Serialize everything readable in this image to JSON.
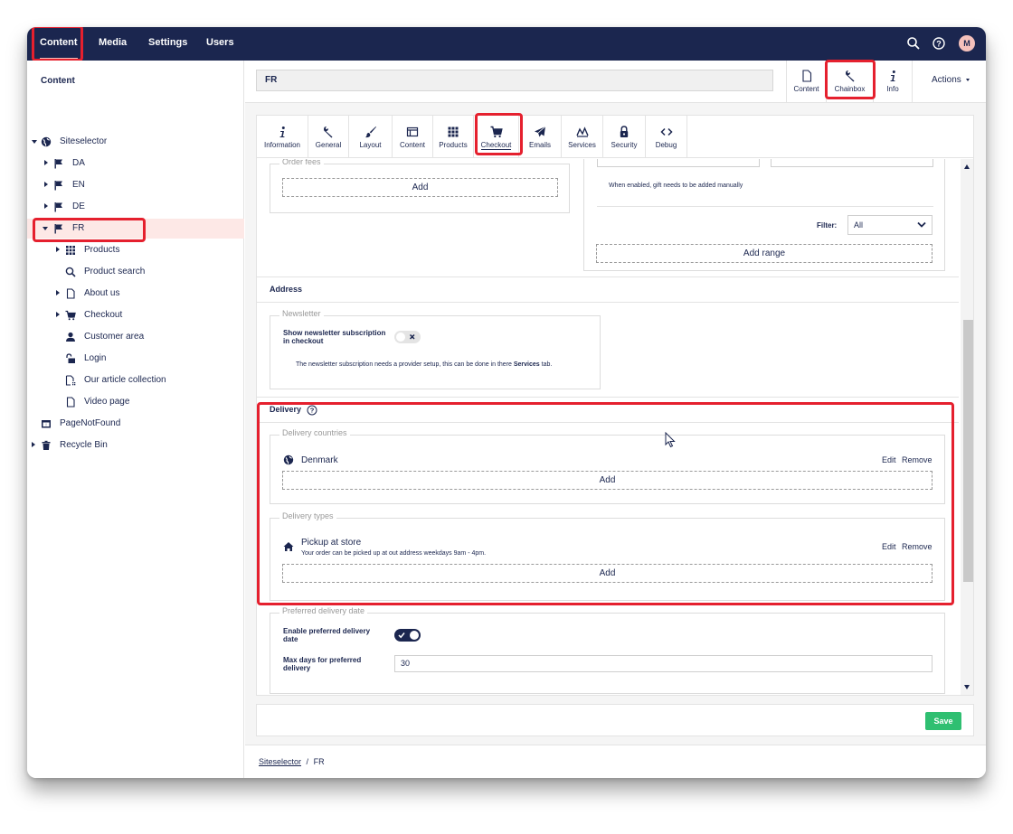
{
  "topnav": {
    "items": [
      "Content",
      "Media",
      "Settings",
      "Users"
    ],
    "avatar_initial": "M",
    "icons": [
      "search-icon",
      "help-icon"
    ]
  },
  "sidebar": {
    "title": "Content",
    "tree": [
      {
        "label": "Siteselector"
      },
      {
        "label": "DA"
      },
      {
        "label": "EN"
      },
      {
        "label": "DE"
      },
      {
        "label": "FR"
      },
      {
        "label": "Products"
      },
      {
        "label": "Product search"
      },
      {
        "label": "About us"
      },
      {
        "label": "Checkout"
      },
      {
        "label": "Customer area"
      },
      {
        "label": "Login"
      },
      {
        "label": "Our article collection"
      },
      {
        "label": "Video page"
      },
      {
        "label": "PageNotFound"
      },
      {
        "label": "Recycle Bin"
      }
    ]
  },
  "header": {
    "node_name": "FR",
    "right_tabs": [
      "Content",
      "Chainbox",
      "Info"
    ],
    "actions_label": "Actions"
  },
  "tabs": [
    "Information",
    "General",
    "Layout",
    "Content",
    "Products",
    "Checkout",
    "Emails",
    "Services",
    "Security",
    "Debug"
  ],
  "checkout": {
    "order_fees_legend": "Order fees",
    "add_label": "Add",
    "gift_note": "When enabled, gift needs to be added manually",
    "filter_label": "Filter:",
    "filter_value": "All",
    "add_range_label": "Add range",
    "address_heading": "Address",
    "newsletter_legend": "Newsletter",
    "newsletter_label": "Show newsletter subscription in checkout",
    "newsletter_help_pre": "The newsletter subscription needs a provider setup, this can be done in there ",
    "newsletter_help_strong": "Services",
    "newsletter_help_post": " tab.",
    "delivery_heading": "Delivery",
    "delivery_countries_legend": "Delivery countries",
    "country_name": "Denmark",
    "edit_label": "Edit",
    "remove_label": "Remove",
    "delivery_types_legend": "Delivery types",
    "delivery_type_name": "Pickup at store",
    "delivery_type_desc": "Your order can be picked up at out address weekdays 9am - 4pm.",
    "preferred_legend": "Preferred delivery date",
    "enable_preferred_label": "Enable preferred delivery date",
    "max_days_label": "Max days for preferred delivery",
    "max_days_value": "30"
  },
  "footer": {
    "save_label": "Save",
    "breadcrumb_root": "Siteselector",
    "breadcrumb_sep": "/",
    "breadcrumb_current": "FR"
  },
  "colors": {
    "navy": "#1b264f",
    "highlight_red": "#e5202e",
    "save_green": "#2fbf71",
    "selection_pink": "#fde8e6"
  }
}
